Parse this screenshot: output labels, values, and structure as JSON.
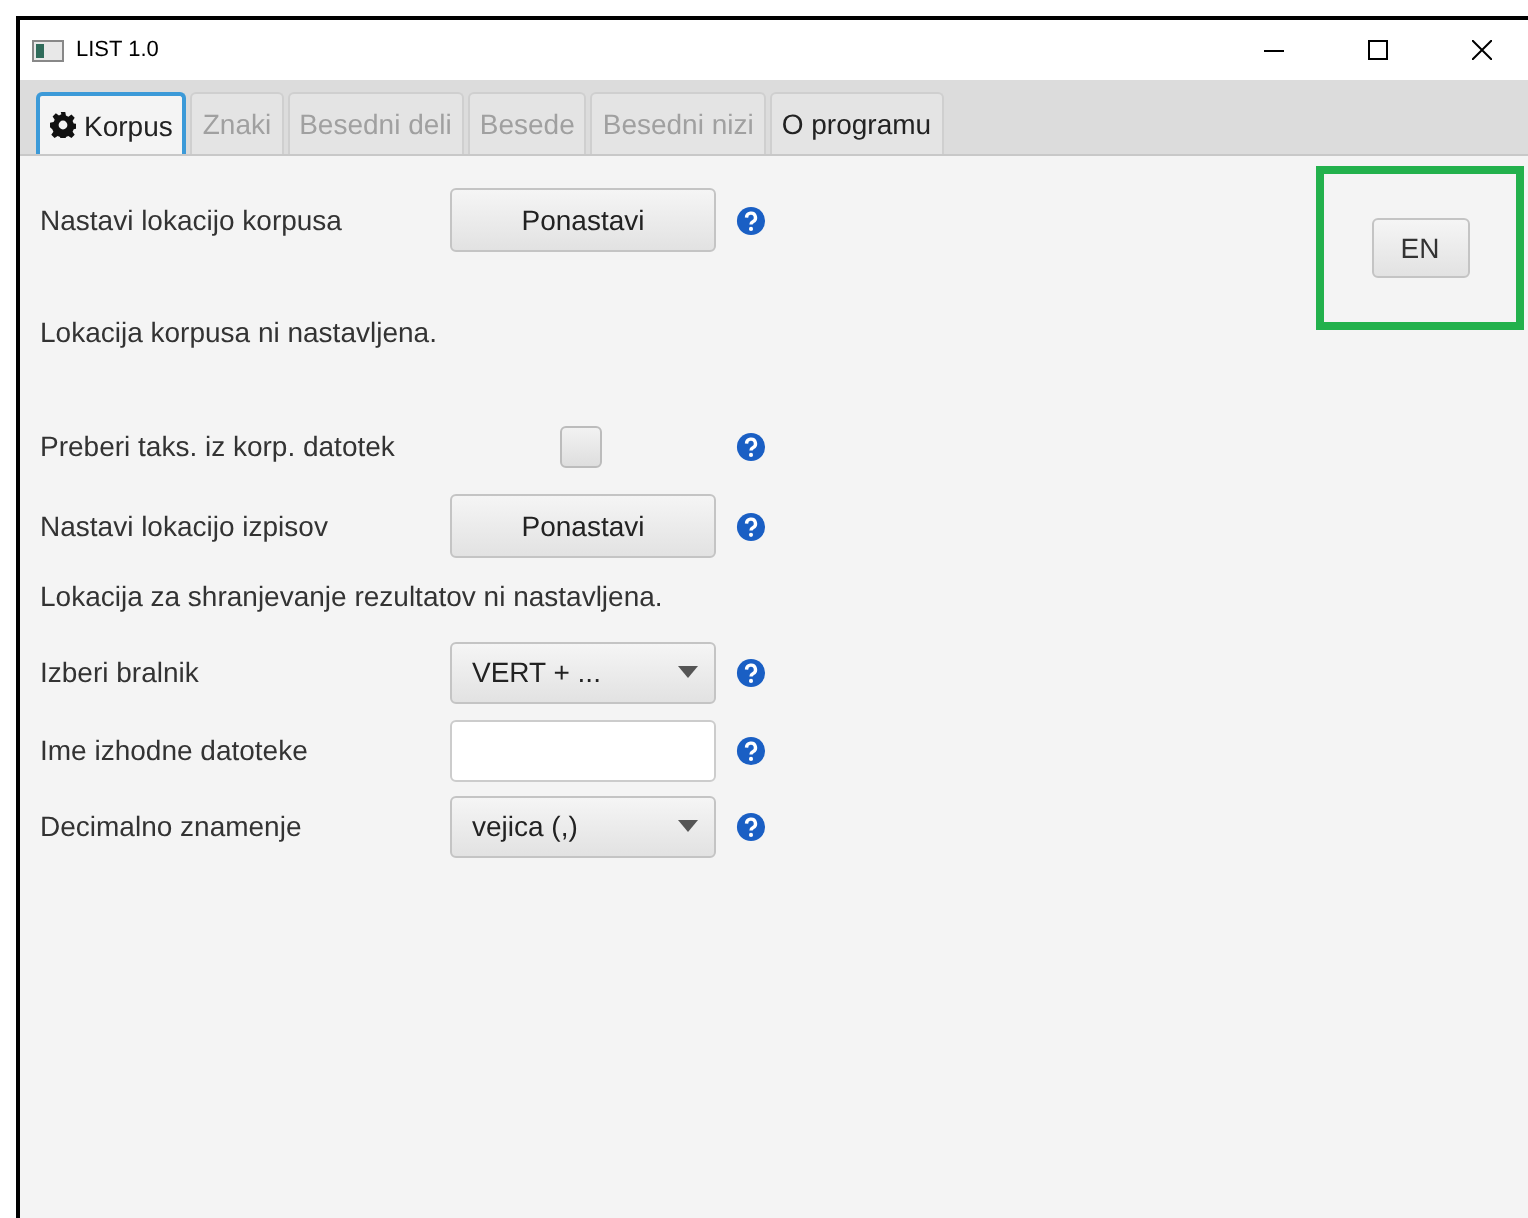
{
  "window": {
    "title": "LIST 1.0"
  },
  "tabs": [
    {
      "label": "Korpus",
      "selected": true,
      "disabled": false,
      "icon": true
    },
    {
      "label": "Znaki",
      "selected": false,
      "disabled": true
    },
    {
      "label": "Besedni deli",
      "selected": false,
      "disabled": true
    },
    {
      "label": "Besede",
      "selected": false,
      "disabled": true
    },
    {
      "label": "Besedni nizi",
      "selected": false,
      "disabled": true
    },
    {
      "label": "O programu",
      "selected": false,
      "disabled": false
    }
  ],
  "rows": [
    {
      "kind": "button",
      "label": "Nastavi lokacijo korpusa",
      "button": "Ponastavi",
      "help": true
    },
    {
      "kind": "text",
      "text": "Lokacija korpusa ni nastavljena."
    },
    {
      "kind": "checkbox",
      "label": "Preberi taks. iz korp. datotek",
      "checked": false,
      "help": true
    },
    {
      "kind": "button",
      "label": "Nastavi lokacijo izpisov",
      "button": "Ponastavi",
      "help": true
    },
    {
      "kind": "text",
      "text": "Lokacija za shranjevanje rezultatov ni nastavljena."
    },
    {
      "kind": "select",
      "label": "Izberi bralnik",
      "value": "VERT + ...",
      "help": true
    },
    {
      "kind": "input",
      "label": "Ime izhodne datoteke",
      "value": "",
      "help": true
    },
    {
      "kind": "select",
      "label": "Decimalno znamenje",
      "value": "vejica (,)",
      "help": true
    }
  ],
  "language_button": {
    "label": "EN",
    "highlighted": true
  }
}
